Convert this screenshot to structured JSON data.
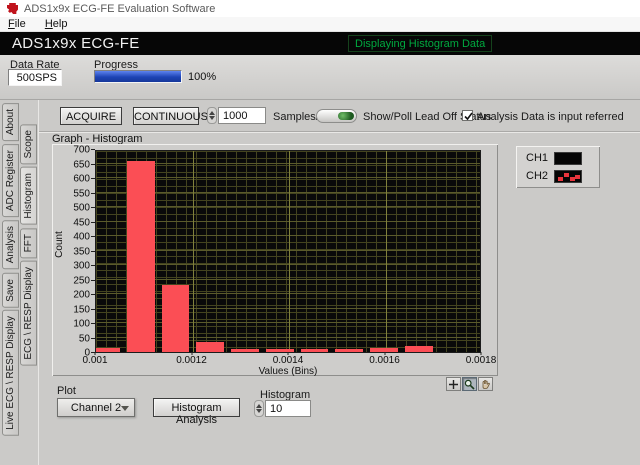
{
  "window": {
    "title": "ADS1x9x ECG-FE Evaluation Software"
  },
  "menu": {
    "items": {
      "file": "File",
      "help": "Help"
    }
  },
  "header": {
    "app_title": "ADS1x9x ECG-FE",
    "status": "Displaying Histogram Data",
    "status_color": "#00a93f"
  },
  "controls": {
    "data_rate_label": "Data Rate",
    "data_rate_value": "500SPS",
    "progress_label": "Progress",
    "progress_percent": "100%",
    "acquire_label": "ACQUIRE",
    "continuous_label": "CONTINUOUS",
    "samples_value": "1000",
    "samples_label": "Samples/CH",
    "leadoff_label": "Show/Poll Lead Off Status",
    "analysis_checkbox_label": "Analysis Data is input referred",
    "analysis_checkbox_checked": true
  },
  "tabs": {
    "outer": [
      "About",
      "ADC Register",
      "Analysis",
      "Save",
      "Live ECG \\ RESP Display"
    ],
    "inner": [
      "Scope",
      "Histogram",
      "FFT",
      "ECG \\ RESP Display"
    ],
    "active": "Histogram"
  },
  "graph": {
    "title": "Graph - Histogram",
    "legend": [
      {
        "label": "CH1"
      },
      {
        "label": "CH2"
      }
    ]
  },
  "chart_data": {
    "type": "bar",
    "title": "Graph - Histogram",
    "xlabel": "Values (Bins)",
    "ylabel": "Count",
    "xlim": [
      0.001,
      0.0018
    ],
    "ylim": [
      0,
      700
    ],
    "x_ticks": [
      0.001,
      0.0012,
      0.0014,
      0.0016,
      0.0018
    ],
    "y_tick_step": 50,
    "bin_width": 7.2e-05,
    "grid": true,
    "plot_bg": "#0a0a0a",
    "bar_color": "#fb4e55",
    "legend_position": "top-right",
    "series": [
      {
        "name": "CH2",
        "bins": [
          {
            "x": 0.001021,
            "count": 15
          },
          {
            "x": 0.001093,
            "count": 660
          },
          {
            "x": 0.001165,
            "count": 230
          },
          {
            "x": 0.001237,
            "count": 35
          },
          {
            "x": 0.001309,
            "count": 10
          },
          {
            "x": 0.001381,
            "count": 10
          },
          {
            "x": 0.001453,
            "count": 12
          },
          {
            "x": 0.001525,
            "count": 10
          },
          {
            "x": 0.001597,
            "count": 15
          },
          {
            "x": 0.001669,
            "count": 22
          }
        ]
      }
    ]
  },
  "footer": {
    "plot_label": "Plot",
    "channel_value": "Channel 2",
    "histogram_analysis_label": "Histogram Analysis",
    "histogram_label": "Histogram",
    "histogram_bins_value": "10"
  }
}
